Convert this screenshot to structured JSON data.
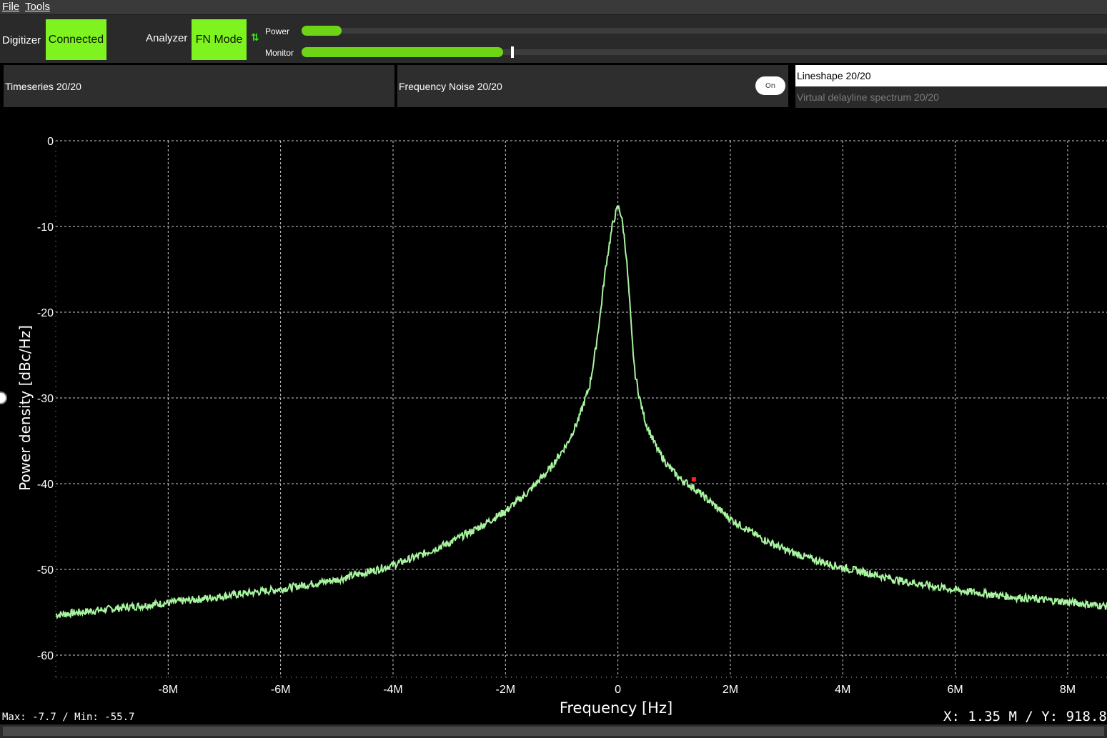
{
  "menu": {
    "file_label": "File",
    "tools_label": "Tools"
  },
  "toolbar": {
    "digitizer_label": "Digitizer",
    "digitizer_status": "Connected",
    "analyzer_label": "Analyzer",
    "analyzer_mode": "FN Mode",
    "power_label": "Power",
    "monitor_label": "Monitor",
    "power_level": 0.05,
    "monitor_level": 0.25,
    "accent_color": "#7ef31f"
  },
  "tabs": {
    "timeseries": "Timeseries 20/20",
    "frequency_noise": "Frequency Noise 20/20",
    "toggle_label": "On",
    "lineshape_selected": "Lineshape 20/20",
    "lineshape_option": "Virtual delayline spectrum 20/20"
  },
  "chart_data": {
    "type": "line",
    "xlabel": "Frequency [Hz]",
    "ylabel": "Power density [dBc/Hz]",
    "x_ticks": [
      {
        "v": -8000000,
        "label": "-8M"
      },
      {
        "v": -6000000,
        "label": "-6M"
      },
      {
        "v": -4000000,
        "label": "-4M"
      },
      {
        "v": -2000000,
        "label": "-2M"
      },
      {
        "v": 0,
        "label": "0"
      },
      {
        "v": 2000000,
        "label": "2M"
      },
      {
        "v": 4000000,
        "label": "4M"
      },
      {
        "v": 6000000,
        "label": "6M"
      },
      {
        "v": 8000000,
        "label": "8M"
      }
    ],
    "y_ticks": [
      {
        "v": 0,
        "label": "0"
      },
      {
        "v": -10,
        "label": "-10"
      },
      {
        "v": -20,
        "label": "-20"
      },
      {
        "v": -30,
        "label": "-30"
      },
      {
        "v": -40,
        "label": "-40"
      },
      {
        "v": -50,
        "label": "-50"
      },
      {
        "v": -60,
        "label": "-60"
      }
    ],
    "xlim": [
      -10000000,
      8700000
    ],
    "ylim": [
      -62,
      0
    ],
    "grid": true,
    "line_color": "#a8f5a0",
    "series": [
      {
        "x": [
          -10000000,
          -9000000,
          -8000000,
          -7000000,
          -6000000,
          -5000000,
          -4500000,
          -4000000,
          -3500000,
          -3000000,
          -2500000,
          -2000000,
          -1600000,
          -1200000,
          -900000,
          -700000,
          -500000,
          -400000,
          -300000,
          -250000,
          -200000,
          -150000,
          -100000,
          -50000,
          0,
          30000,
          60000,
          100000,
          150000,
          200000,
          250000,
          300000,
          400000,
          500000,
          700000,
          900000,
          1100000,
          1350000,
          1600000,
          2000000,
          2500000,
          3000000,
          3500000,
          4000000,
          4500000,
          5000000,
          6000000,
          7000000,
          8000000,
          8700000
        ],
        "y": [
          -55.3,
          -54.6,
          -53.9,
          -53.1,
          -52.3,
          -51.2,
          -50.4,
          -49.5,
          -48.3,
          -46.9,
          -45.2,
          -43.2,
          -41.0,
          -38.2,
          -35.3,
          -32.5,
          -28.5,
          -24.5,
          -19.5,
          -16.5,
          -14.0,
          -12.0,
          -10.0,
          -8.7,
          -7.7,
          -8.0,
          -8.8,
          -10.5,
          -13.5,
          -18.0,
          -23.0,
          -27.0,
          -30.5,
          -33.0,
          -36.0,
          -38.0,
          -39.4,
          -40.5,
          -41.9,
          -44.1,
          -46.2,
          -47.8,
          -48.9,
          -49.8,
          -50.5,
          -51.3,
          -52.4,
          -53.2,
          -53.8,
          -54.3
        ]
      }
    ],
    "marker": {
      "x": 1350000,
      "y": -39.5,
      "color": "#ff2020"
    }
  },
  "readouts": {
    "maxmin": "Max: -7.7 / Min: -55.7",
    "cursor": "X: 1.35 M / Y: 918.8"
  }
}
